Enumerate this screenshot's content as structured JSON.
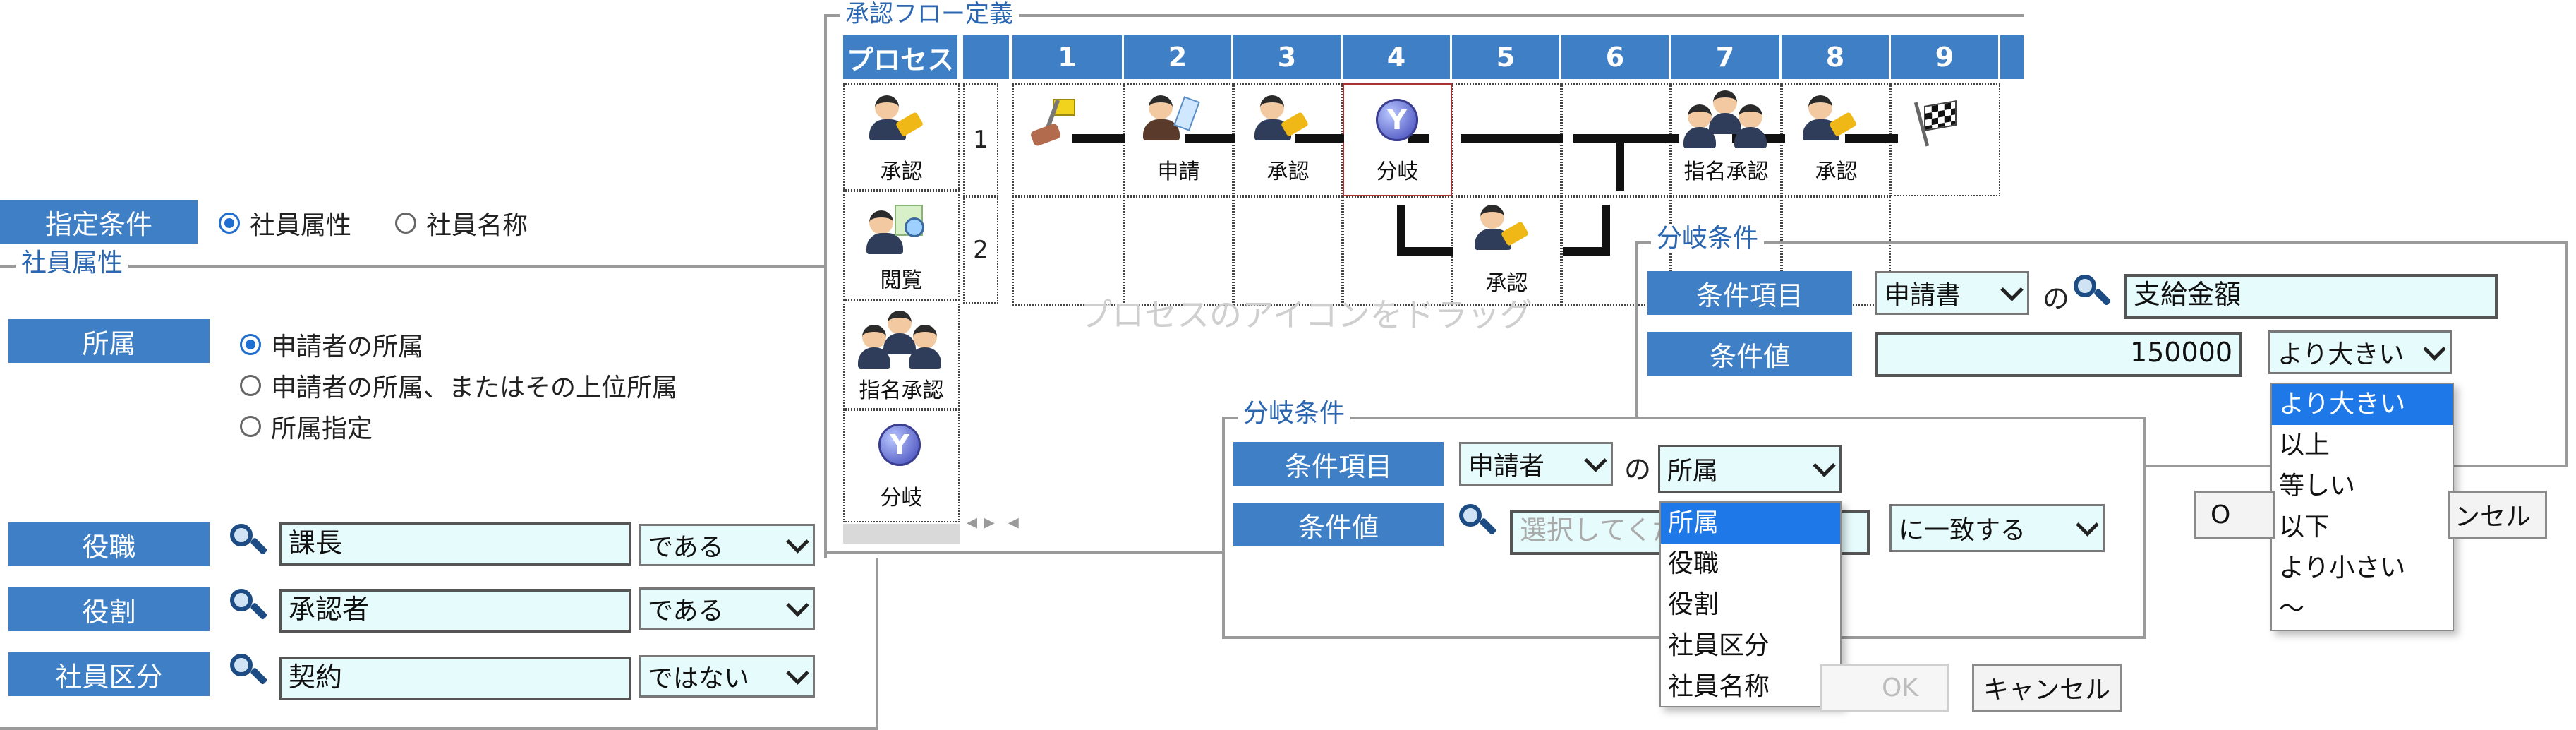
{
  "left_panel": {
    "designation_label": "指定条件",
    "radio_employee_attr": "社員属性",
    "radio_employee_name": "社員名称",
    "employee_attr_legend": "社員属性",
    "affiliation_label": "所属",
    "affiliation_options": [
      "申請者の所属",
      "申請者の所属、またはその上位所属",
      "所属指定"
    ],
    "position_label": "役職",
    "position_value": "課長",
    "position_op": "である",
    "role_label": "役割",
    "role_value": "承認者",
    "role_op": "である",
    "class_label": "社員区分",
    "class_value": "契約",
    "class_op": "ではない"
  },
  "flow": {
    "legend": "承認フロー定義",
    "process_header": "プロセス",
    "columns": [
      "1",
      "2",
      "3",
      "4",
      "5",
      "6",
      "7",
      "8",
      "9"
    ],
    "rows": [
      "1",
      "2"
    ],
    "palette": [
      "承認",
      "閲覧",
      "指名承認",
      "分岐"
    ],
    "row1_labels": [
      "申請",
      "承認",
      "分岐",
      "指名承認",
      "承認"
    ],
    "row2_label": "承認",
    "watermark": "プロセスのアイコンをドラッグ"
  },
  "branch_back": {
    "legend": "分岐条件",
    "item_label": "条件項目",
    "item_select": "申請書",
    "of": "の",
    "item_value": "支給金額",
    "value_label": "条件値",
    "value": "150000",
    "op_select": "より大きい",
    "op_options": [
      "より大きい",
      "以上",
      "等しい",
      "以下",
      "より小さい",
      "～"
    ],
    "cancel_partial": "ンセル",
    "ok_partial": "O"
  },
  "branch_front": {
    "legend": "分岐条件",
    "item_label": "条件項目",
    "item_select": "申請者",
    "of": "の",
    "attr_select": "所属",
    "attr_options": [
      "所属",
      "役職",
      "役割",
      "社員区分",
      "社員名称"
    ],
    "value_label": "条件値",
    "value_placeholder": "選択してくだ",
    "match_select": "に一致する",
    "ok_label": "OK",
    "cancel_label": "キャンセル"
  }
}
